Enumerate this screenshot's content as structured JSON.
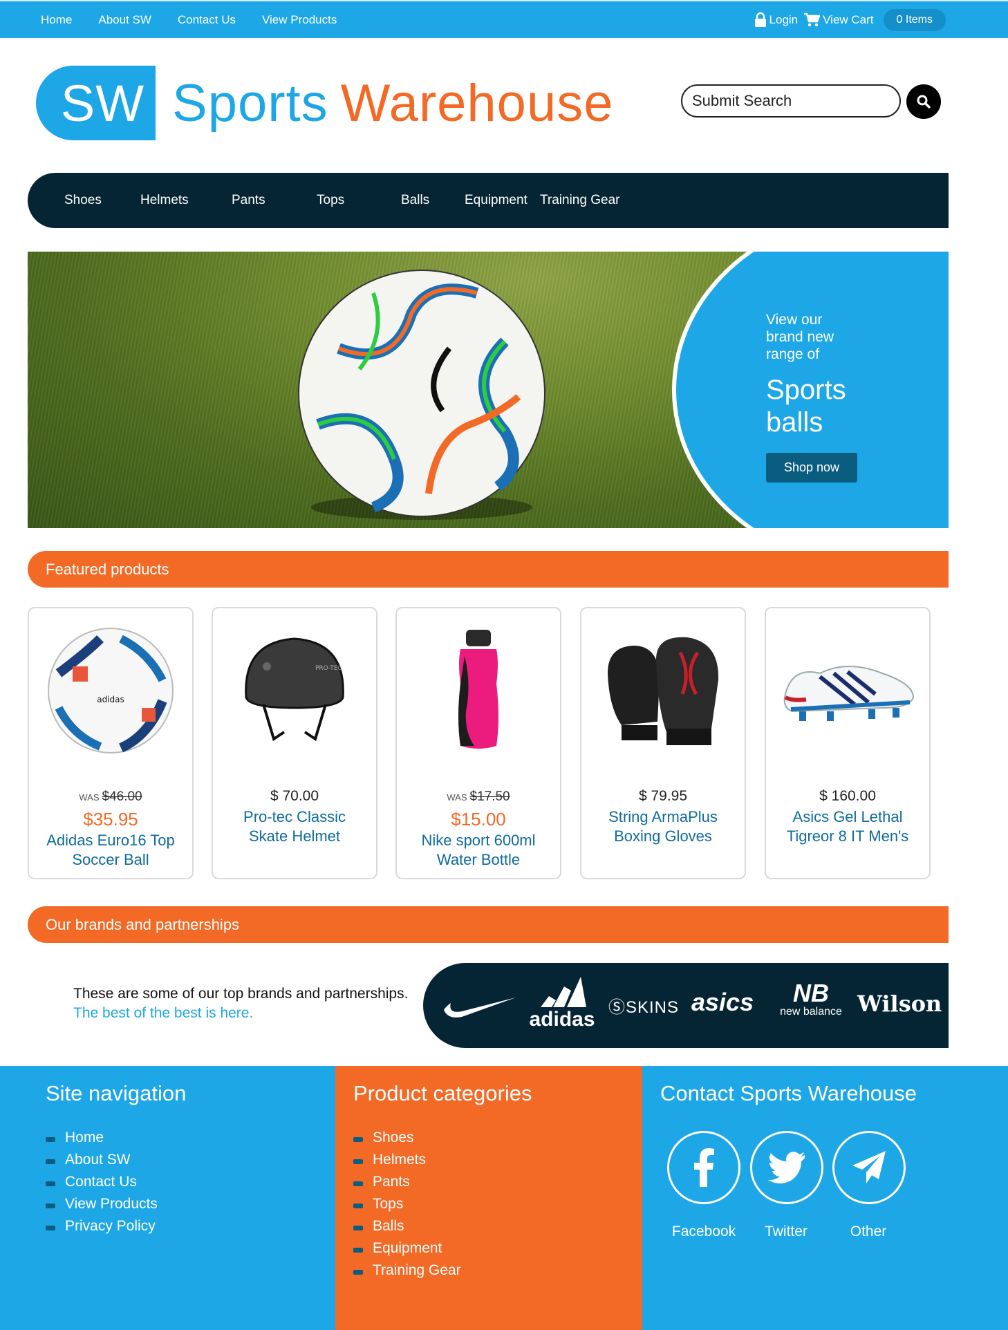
{
  "topnav": {
    "links": [
      "Home",
      "About SW",
      "Contact Us",
      "View Products"
    ],
    "login": "Login",
    "view_cart": "View Cart",
    "items": "0 Items"
  },
  "header": {
    "logo_badge": "SW",
    "logo_word1": "Sports",
    "logo_word2": "Warehouse",
    "search_placeholder": "Submit Search"
  },
  "categories": [
    "Shoes",
    "Helmets",
    "Pants",
    "Tops",
    "Balls",
    "Equipment",
    "Training Gear"
  ],
  "hero": {
    "small_text": "View our brand new range of",
    "big_text": "Sports balls",
    "button": "Shop now"
  },
  "featured": {
    "title": "Featured products",
    "products": [
      {
        "was_label": "WAS",
        "was": "$46.00",
        "price": "$35.95",
        "name": "Adidas Euro16 Top Soccer Ball",
        "image": "soccer-ball"
      },
      {
        "price": "$ 70.00",
        "name": "Pro-tec Classic Skate Helmet",
        "image": "helmet"
      },
      {
        "was_label": "WAS",
        "was": "$17.50",
        "price": "$15.00",
        "name": "Nike sport 600ml Water Bottle",
        "image": "water-bottle"
      },
      {
        "price": "$ 79.95",
        "name": "String ArmaPlus Boxing Gloves",
        "image": "boxing-gloves"
      },
      {
        "price": "$ 160.00",
        "name": "Asics Gel Lethal Tigreor 8 IT Men's",
        "image": "football-boot"
      }
    ]
  },
  "brands": {
    "title": "Our brands and partnerships",
    "text": "These are some of our top brands and partnerships.",
    "link": "The best of the best is here.",
    "logos": [
      "adidas",
      "SKINS",
      "asics",
      "new balance",
      "Wilson"
    ]
  },
  "footer": {
    "nav_title": "Site navigation",
    "nav_links": [
      "Home",
      "About SW",
      "Contact Us",
      "View Products",
      "Privacy Policy"
    ],
    "cat_title": "Product categories",
    "cat_links": [
      "Shoes",
      "Helmets",
      "Pants",
      "Tops",
      "Balls",
      "Equipment",
      "Training Gear"
    ],
    "contact_title": "Contact Sports Warehouse",
    "social": [
      "Facebook",
      "Twitter",
      "Other"
    ]
  },
  "colors": {
    "brand_blue": "#1ea7e6",
    "brand_orange": "#f26a26",
    "dark_navy": "#062534"
  }
}
